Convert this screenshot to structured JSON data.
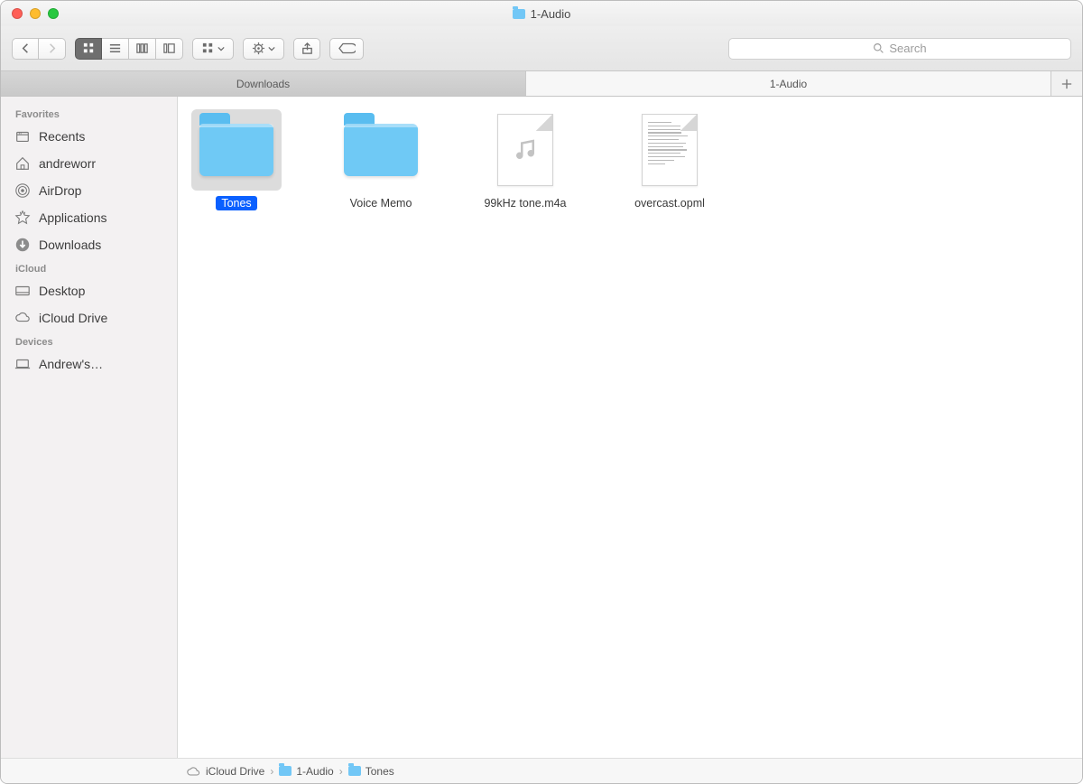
{
  "window": {
    "title": "1-Audio"
  },
  "search": {
    "placeholder": "Search"
  },
  "tabs": [
    {
      "label": "Downloads",
      "active": false
    },
    {
      "label": "1-Audio",
      "active": true
    }
  ],
  "sidebar": {
    "sections": [
      {
        "heading": "Favorites",
        "items": [
          {
            "icon": "recents-icon",
            "label": "Recents"
          },
          {
            "icon": "home-icon",
            "label": "andreworr"
          },
          {
            "icon": "airdrop-icon",
            "label": "AirDrop"
          },
          {
            "icon": "applications-icon",
            "label": "Applications"
          },
          {
            "icon": "downloads-icon",
            "label": "Downloads"
          }
        ]
      },
      {
        "heading": "iCloud",
        "items": [
          {
            "icon": "desktop-icon",
            "label": "Desktop"
          },
          {
            "icon": "icloud-icon",
            "label": "iCloud Drive"
          }
        ]
      },
      {
        "heading": "Devices",
        "items": [
          {
            "icon": "laptop-icon",
            "label": "Andrew's…"
          }
        ]
      }
    ]
  },
  "items": [
    {
      "name": "Tones",
      "kind": "folder",
      "selected": true
    },
    {
      "name": "Voice Memo",
      "kind": "folder",
      "selected": false
    },
    {
      "name": "99kHz tone.m4a",
      "kind": "audio",
      "selected": false
    },
    {
      "name": "overcast.opml",
      "kind": "text",
      "selected": false
    }
  ],
  "pathbar": [
    {
      "icon": "icloud-icon",
      "label": "iCloud Drive"
    },
    {
      "icon": "folder-icon",
      "label": "1-Audio"
    },
    {
      "icon": "folder-icon",
      "label": "Tones"
    }
  ]
}
